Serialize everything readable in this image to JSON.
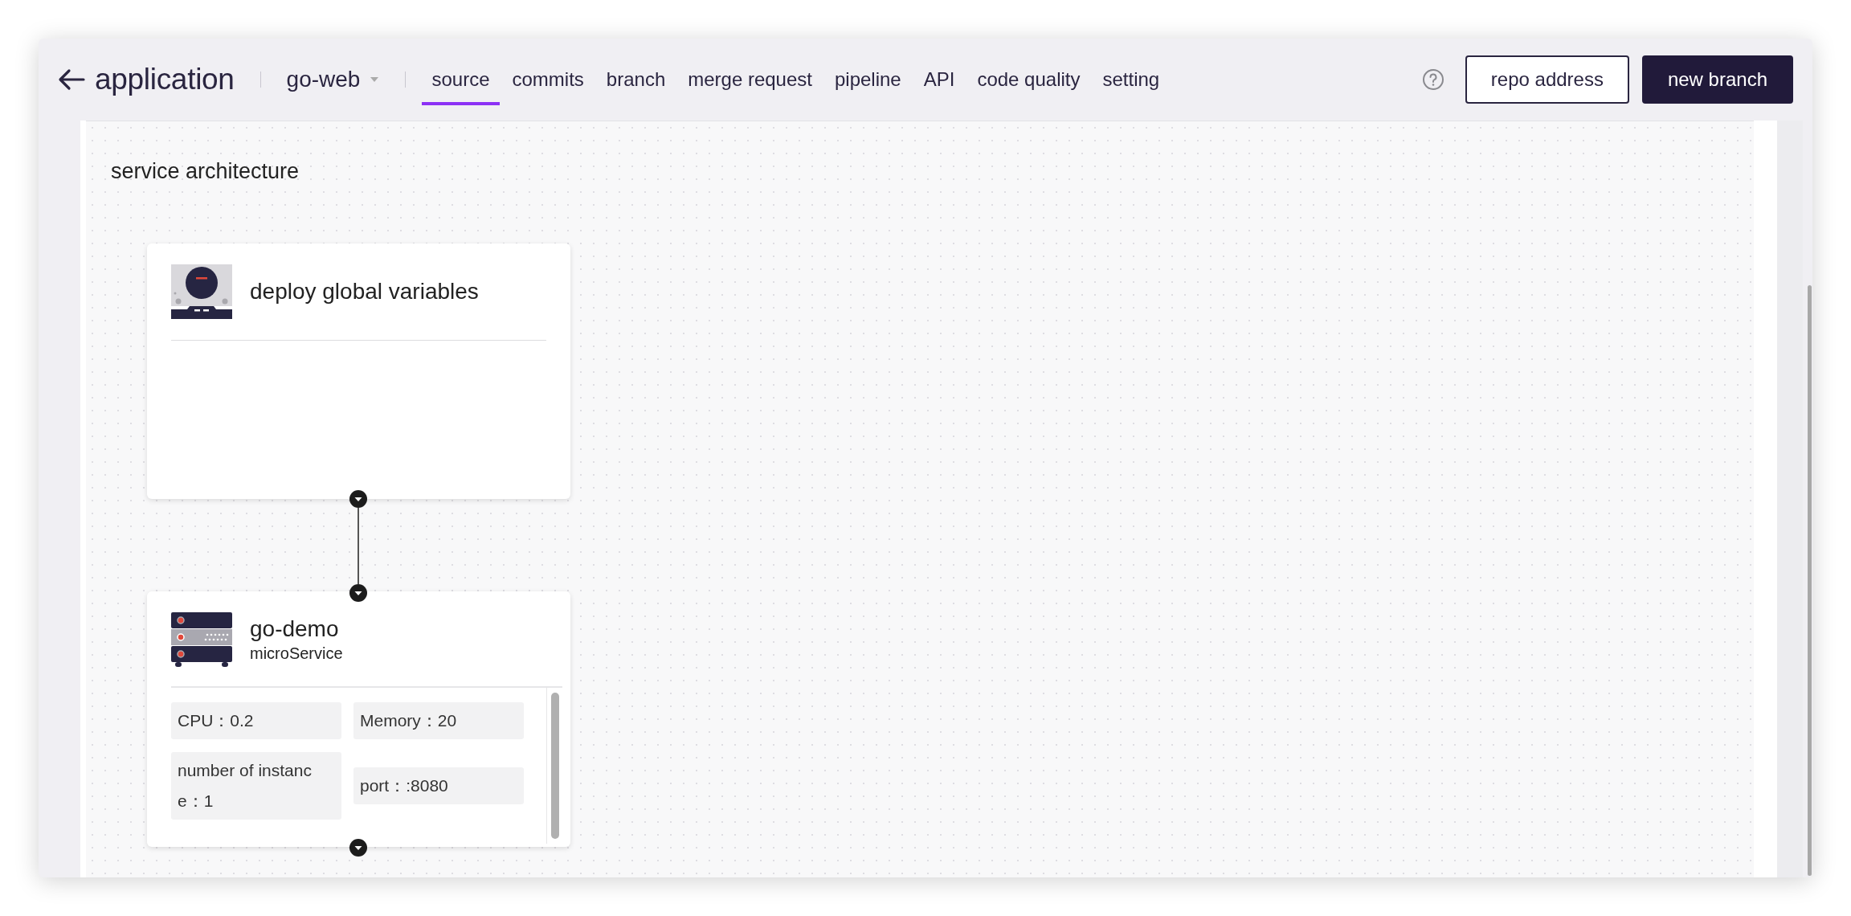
{
  "header": {
    "title": "application",
    "project": "go-web",
    "tabs": [
      {
        "label": "source",
        "selected": true
      },
      {
        "label": "commits",
        "selected": false
      },
      {
        "label": "branch",
        "selected": false
      },
      {
        "label": "merge request",
        "selected": false
      },
      {
        "label": "pipeline",
        "selected": false
      },
      {
        "label": "API",
        "selected": false
      },
      {
        "label": "code quality",
        "selected": false
      },
      {
        "label": "setting",
        "selected": false
      }
    ],
    "buttons": [
      {
        "label": "repo address",
        "kind": "outline"
      },
      {
        "label": "new branch",
        "kind": "primary"
      }
    ]
  },
  "canvas": {
    "title": "service architecture",
    "nodes": [
      {
        "kind": "global",
        "title": "deploy global variables"
      },
      {
        "kind": "service",
        "title": "go-demo",
        "subtitle": "microService",
        "fields": [
          "CPU：0.2",
          "Memory：20",
          "number of instance：1",
          "port：:8080"
        ]
      }
    ]
  }
}
